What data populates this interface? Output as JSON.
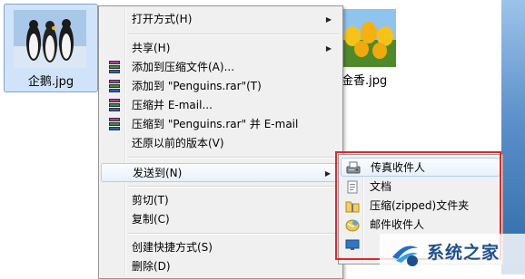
{
  "files": {
    "selected": {
      "name": "企鹅.jpg"
    },
    "other": {
      "name": "金香.jpg"
    }
  },
  "context_menu": {
    "items": [
      {
        "label": "打开方式(H)",
        "submenu": true
      },
      {
        "label": "共享(H)",
        "submenu": true
      },
      {
        "label": "添加到压缩文件(A)...",
        "icon": "winrar-icon"
      },
      {
        "label": "添加到 \"Penguins.rar\"(T)",
        "icon": "winrar-icon"
      },
      {
        "label": "压缩并 E-mail...",
        "icon": "winrar-icon"
      },
      {
        "label": "压缩到 \"Penguins.rar\" 并 E-mail",
        "icon": "winrar-icon"
      },
      {
        "label": "还原以前的版本(V)"
      },
      {
        "label": "发送到(N)",
        "submenu": true,
        "highlighted": true
      },
      {
        "label": "剪切(T)"
      },
      {
        "label": "复制(C)"
      },
      {
        "label": "创建快捷方式(S)"
      },
      {
        "label": "删除(D)"
      }
    ]
  },
  "send_to_menu": {
    "items": [
      {
        "label": "传真收件人",
        "icon": "fax-icon",
        "highlighted": true
      },
      {
        "label": "文档",
        "icon": "documents-icon"
      },
      {
        "label": "压缩(zipped)文件夹",
        "icon": "zip-folder-icon"
      },
      {
        "label": "邮件收件人",
        "icon": "mail-recipient-icon"
      }
    ]
  },
  "colors": {
    "highlight_frame": "#e3262a",
    "menu_background": "#f0f0f0",
    "selection": "#cfe4fb",
    "watermark_text": "#1d4f8e"
  },
  "watermark": {
    "text": "系统之家"
  }
}
